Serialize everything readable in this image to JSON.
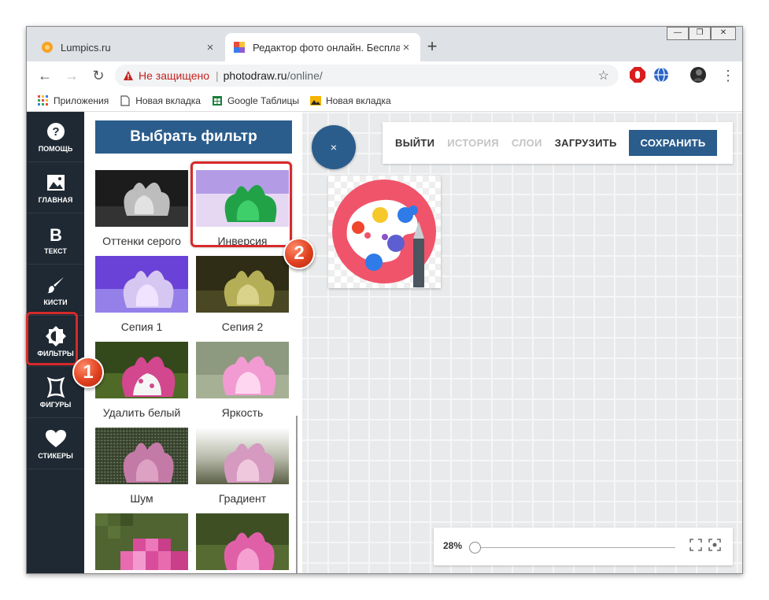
{
  "browser": {
    "tabs": [
      {
        "title": "Lumpics.ru",
        "close": "×"
      },
      {
        "title": "Редактор фото онлайн. Бесплатный",
        "close": "×"
      }
    ],
    "new_tab": "+",
    "window_controls": [
      "—",
      "❐",
      "✕"
    ],
    "nav": {
      "back": "←",
      "forward": "→",
      "reload": "↻"
    },
    "security_label": "Не защищено",
    "separator": "|",
    "url_host": "photodraw.ru",
    "url_path": "/online/",
    "star": "☆",
    "menu": "⋮",
    "bookmarks": [
      "Приложения",
      "Новая вкладка",
      "Google Таблицы",
      "Новая вкладка"
    ]
  },
  "sidebar": {
    "items": [
      {
        "label": "ПОМОЩЬ",
        "icon": "help-icon"
      },
      {
        "label": "ГЛАВНАЯ",
        "icon": "image-icon"
      },
      {
        "label": "ТЕКСТ",
        "icon": "text-icon"
      },
      {
        "label": "КИСТИ",
        "icon": "brush-icon"
      },
      {
        "label": "ФИЛЬТРЫ",
        "icon": "filter-icon"
      },
      {
        "label": "ФИГУРЫ",
        "icon": "shape-icon"
      },
      {
        "label": "СТИКЕРЫ",
        "icon": "heart-icon"
      }
    ],
    "help_glyph": "?",
    "text_glyph": "B"
  },
  "filter_panel": {
    "header": "Выбрать фильтр",
    "filters": [
      "Оттенки серого",
      "Инверсия",
      "Сепия 1",
      "Сепия 2",
      "Удалить белый",
      "Яркость",
      "Шум",
      "Градиент",
      "",
      ""
    ]
  },
  "annotations": {
    "badge_1": "1",
    "badge_2": "2"
  },
  "editor": {
    "close": "×",
    "toolbar": {
      "exit": "ВЫЙТИ",
      "history": "ИСТОРИЯ",
      "layers": "СЛОИ",
      "upload": "ЗАГРУЗИТЬ",
      "save": "СОХРАНИТЬ"
    },
    "zoom": {
      "label": "28%",
      "level": 0.28
    }
  },
  "colors": {
    "sidebar_bg": "#1f2933",
    "accent": "#2b5d8c",
    "highlight": "#d72a2a",
    "palette_pink": "#f0546a"
  }
}
